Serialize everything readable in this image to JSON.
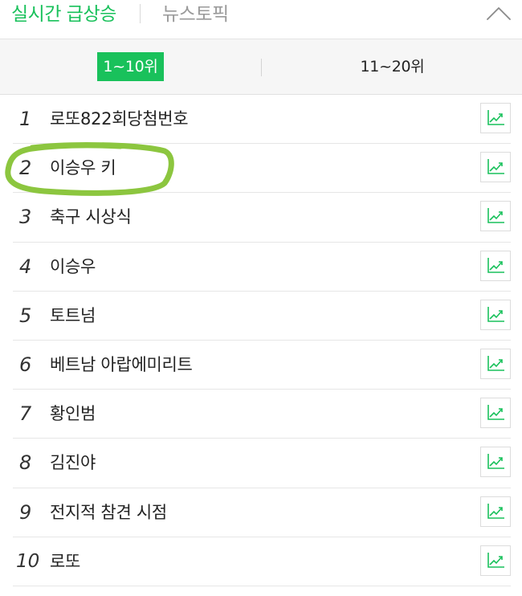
{
  "header": {
    "tab_realtime": "실시간 급상승",
    "tab_news": "뉴스토픽",
    "collapse_icon": "chevron-up-icon"
  },
  "range_tabs": {
    "active": "1~10위",
    "inactive": "11~20위"
  },
  "colors": {
    "accent": "#19c15b",
    "highlight": "#8cc63f"
  },
  "items": [
    {
      "rank": "1",
      "keyword": "로또822회당첨번호",
      "icon": "trend-chart-icon"
    },
    {
      "rank": "2",
      "keyword": "이승우 키",
      "icon": "trend-chart-icon"
    },
    {
      "rank": "3",
      "keyword": "축구 시상식",
      "icon": "trend-chart-icon"
    },
    {
      "rank": "4",
      "keyword": "이승우",
      "icon": "trend-chart-icon"
    },
    {
      "rank": "5",
      "keyword": "토트넘",
      "icon": "trend-chart-icon"
    },
    {
      "rank": "6",
      "keyword": "베트남 아랍에미리트",
      "icon": "trend-chart-icon"
    },
    {
      "rank": "7",
      "keyword": "황인범",
      "icon": "trend-chart-icon"
    },
    {
      "rank": "8",
      "keyword": "김진야",
      "icon": "trend-chart-icon"
    },
    {
      "rank": "9",
      "keyword": "전지적 참견 시점",
      "icon": "trend-chart-icon"
    },
    {
      "rank": "10",
      "keyword": "로또",
      "icon": "trend-chart-icon"
    }
  ]
}
